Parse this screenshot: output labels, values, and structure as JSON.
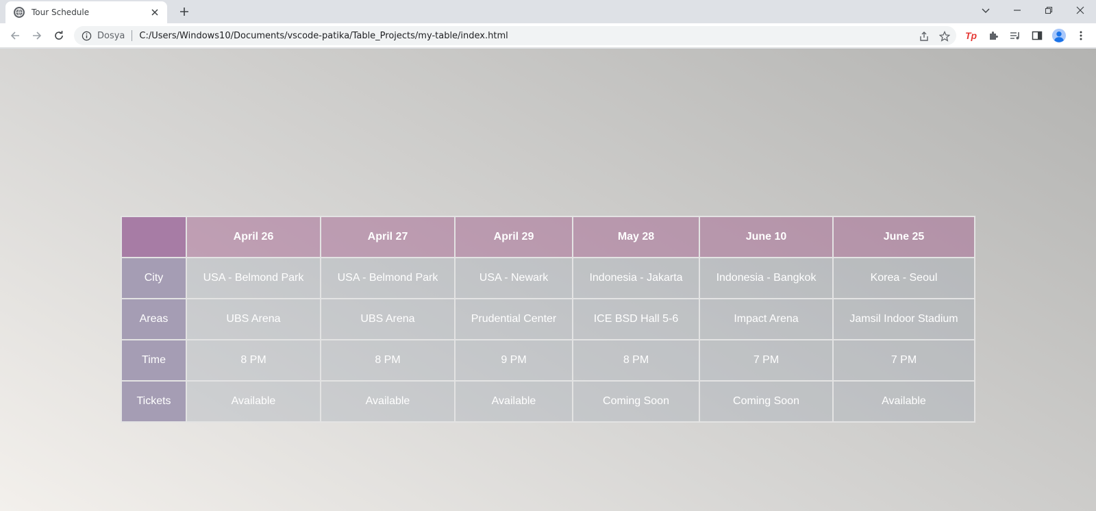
{
  "browser": {
    "tab_title": "Tour Schedule",
    "site_label": "Dosya",
    "url": "C:/Users/Windows10/Documents/vscode-patika/Table_Projects/my-table/index.html"
  },
  "table": {
    "columns": [
      "April 26",
      "April 27",
      "April 29",
      "May 28",
      "June 10",
      "June 25"
    ],
    "rows": [
      {
        "label": "City",
        "cells": [
          "USA - Belmond Park",
          "USA - Belmond Park",
          "USA - Newark",
          "Indonesia - Jakarta",
          "Indonesia - Bangkok",
          "Korea - Seoul"
        ]
      },
      {
        "label": "Areas",
        "cells": [
          "UBS Arena",
          "UBS Arena",
          "Prudential Center",
          "ICE BSD Hall 5-6",
          "Impact Arena",
          "Jamsil Indoor Stadium"
        ]
      },
      {
        "label": "Time",
        "cells": [
          "8 PM",
          "8 PM",
          "9 PM",
          "8 PM",
          "7 PM",
          "7 PM"
        ]
      },
      {
        "label": "Tickets",
        "cells": [
          "Available",
          "Available",
          "Available",
          "Coming Soon",
          "Coming Soon",
          "Available"
        ]
      }
    ]
  },
  "colors": {
    "header_bg": "#b58fae",
    "corner_bg": "#a77ca5",
    "rowhead_bg": "#a59db4",
    "cell_bg": "#bfc4c8"
  }
}
